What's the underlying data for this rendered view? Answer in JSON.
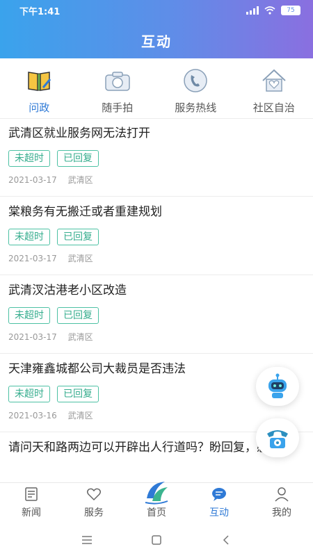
{
  "status_bar": {
    "time": "下午1:41",
    "battery": "75"
  },
  "header": {
    "title": "互动"
  },
  "categories": [
    {
      "label": "问政",
      "icon": "book-icon",
      "active": true
    },
    {
      "label": "随手拍",
      "icon": "camera-icon",
      "active": false
    },
    {
      "label": "服务热线",
      "icon": "phone-icon",
      "active": false
    },
    {
      "label": "社区自治",
      "icon": "house-heart-icon",
      "active": false
    }
  ],
  "posts": [
    {
      "title": "武清区就业服务网无法打开",
      "tags": [
        "未超时",
        "已回复"
      ],
      "date": "2021-03-17",
      "district": "武清区"
    },
    {
      "title": "棠粮务有无搬迁或者重建规划",
      "tags": [
        "未超时",
        "已回复"
      ],
      "date": "2021-03-17",
      "district": "武清区"
    },
    {
      "title": "武清汊沽港老小区改造",
      "tags": [
        "未超时",
        "已回复"
      ],
      "date": "2021-03-17",
      "district": "武清区"
    },
    {
      "title": "天津雍鑫城都公司大裁员是否违法",
      "tags": [
        "未超时",
        "已回复"
      ],
      "date": "2021-03-16",
      "district": "武清区"
    },
    {
      "title": "请问天和路两边可以开辟出人行道吗？盼回复，感谢",
      "tags": [],
      "date": "",
      "district": ""
    }
  ],
  "floating": {
    "robot_icon": "robot-icon",
    "phone_icon": "telephone-icon"
  },
  "bottom_nav": [
    {
      "label": "新闻",
      "icon": "news-icon",
      "active": false
    },
    {
      "label": "服务",
      "icon": "heart-icon",
      "active": false
    },
    {
      "label": "首页",
      "icon": "logo-icon",
      "active": false
    },
    {
      "label": "互动",
      "icon": "chat-icon",
      "active": true
    },
    {
      "label": "我的",
      "icon": "user-icon",
      "active": false
    }
  ],
  "colors": {
    "accent": "#2f7ad6",
    "tag": "#36ad8e",
    "header_start": "#3aa3ec",
    "header_end": "#8a6fe0"
  }
}
